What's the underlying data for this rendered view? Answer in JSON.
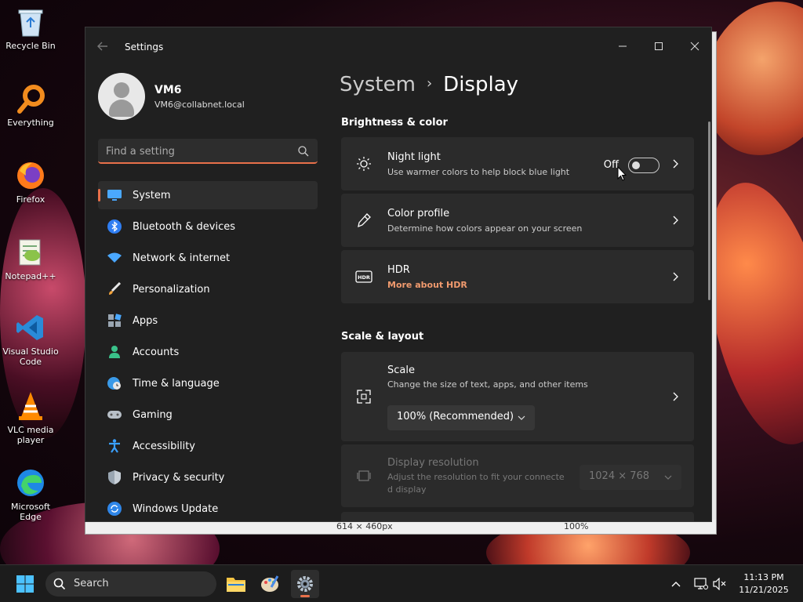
{
  "desktop": {
    "icons": [
      {
        "label": "Recycle Bin",
        "icon": "recycle-bin-icon"
      },
      {
        "label": "Everything",
        "icon": "everything-search-icon"
      },
      {
        "label": "Firefox",
        "icon": "firefox-icon"
      },
      {
        "label": "Notepad++",
        "icon": "notepad-plus-plus-icon"
      },
      {
        "label": "Visual Studio Code",
        "icon": "vscode-icon"
      },
      {
        "label": "VLC media player",
        "icon": "vlc-icon"
      },
      {
        "label": "Microsoft Edge",
        "icon": "edge-icon"
      }
    ]
  },
  "background_window": {
    "status_dims": "614 × 460px",
    "zoom": "100%"
  },
  "window": {
    "title": "Settings",
    "accent": "#e8704a"
  },
  "profile": {
    "name": "VM6",
    "email": "VM6@collabnet.local"
  },
  "search": {
    "placeholder": "Find a setting"
  },
  "nav": {
    "items": [
      {
        "label": "System",
        "icon": "monitor-icon",
        "active": true
      },
      {
        "label": "Bluetooth & devices",
        "icon": "bluetooth-icon"
      },
      {
        "label": "Network & internet",
        "icon": "wifi-icon"
      },
      {
        "label": "Personalization",
        "icon": "brush-icon"
      },
      {
        "label": "Apps",
        "icon": "apps-icon"
      },
      {
        "label": "Accounts",
        "icon": "person-icon"
      },
      {
        "label": "Time & language",
        "icon": "globe-clock-icon"
      },
      {
        "label": "Gaming",
        "icon": "gamepad-icon"
      },
      {
        "label": "Accessibility",
        "icon": "accessibility-icon"
      },
      {
        "label": "Privacy & security",
        "icon": "shield-icon"
      },
      {
        "label": "Windows Update",
        "icon": "update-icon"
      }
    ]
  },
  "breadcrumb": {
    "parent": "System",
    "current": "Display"
  },
  "sections": {
    "brightness": {
      "title": "Brightness & color",
      "night_light": {
        "title": "Night light",
        "subtitle": "Use warmer colors to help block blue light",
        "toggle_label": "Off"
      },
      "color_profile": {
        "title": "Color profile",
        "subtitle": "Determine how colors appear on your screen"
      },
      "hdr": {
        "title": "HDR",
        "link": "More about HDR"
      }
    },
    "scale_layout": {
      "title": "Scale & layout",
      "scale": {
        "title": "Scale",
        "subtitle": "Change the size of text, apps, and other items",
        "value": "100% (Recommended)"
      },
      "resolution": {
        "title": "Display resolution",
        "subtitle_line1": "Adjust the resolution to fit your connecte",
        "subtitle_line2": "d display",
        "value": "1024 × 768"
      }
    }
  },
  "taskbar": {
    "search_label": "Search",
    "time": "11:13 PM",
    "date": "11/21/2025"
  }
}
